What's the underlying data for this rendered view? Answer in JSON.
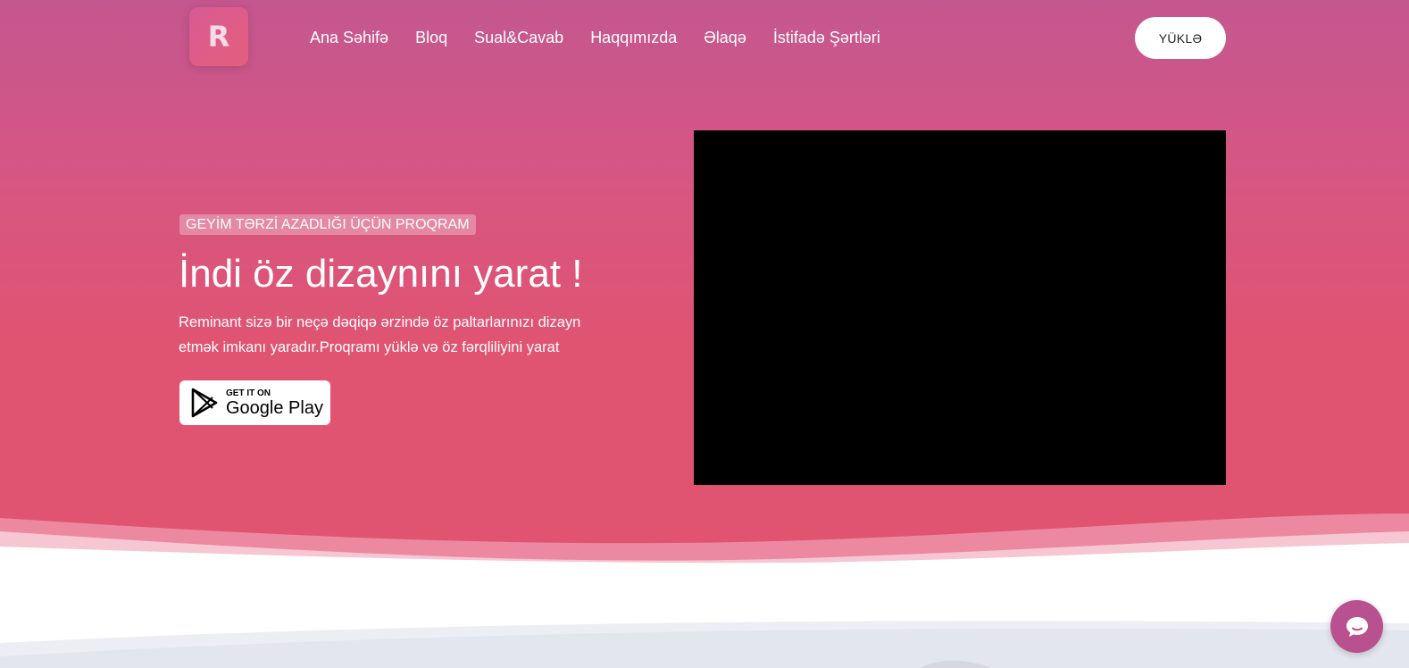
{
  "header": {
    "logo_letter": "R",
    "nav": [
      {
        "label": "Ana Səhifə"
      },
      {
        "label": "Bloq"
      },
      {
        "label": "Sual&Cavab"
      },
      {
        "label": "Haqqımızda"
      },
      {
        "label": "Əlaqə"
      },
      {
        "label": "İstifadə Şərtləri"
      }
    ],
    "cta_label": "YÜKLƏ"
  },
  "hero": {
    "badge": "GEYİM TƏRZİ AZADLIĞI ÜÇÜN PROQRAM",
    "headline": "İndi öz dizaynını yarat !",
    "description": "Reminant sizə bir neçə dəqiqə ərzində öz paltarlarınızı dizayn etmək imkanı yaradır.Proqramı yüklə və öz fərqliliyini yarat",
    "store_badge": {
      "small": "GET IT ON",
      "big": "Google Play",
      "icon": "google-play-icon"
    }
  },
  "colors": {
    "gradient_top": "#c4578f",
    "gradient_bottom": "#e05472",
    "chat_button": "#b9508f"
  },
  "icons": {
    "chat": "chat-bubble-icon"
  }
}
